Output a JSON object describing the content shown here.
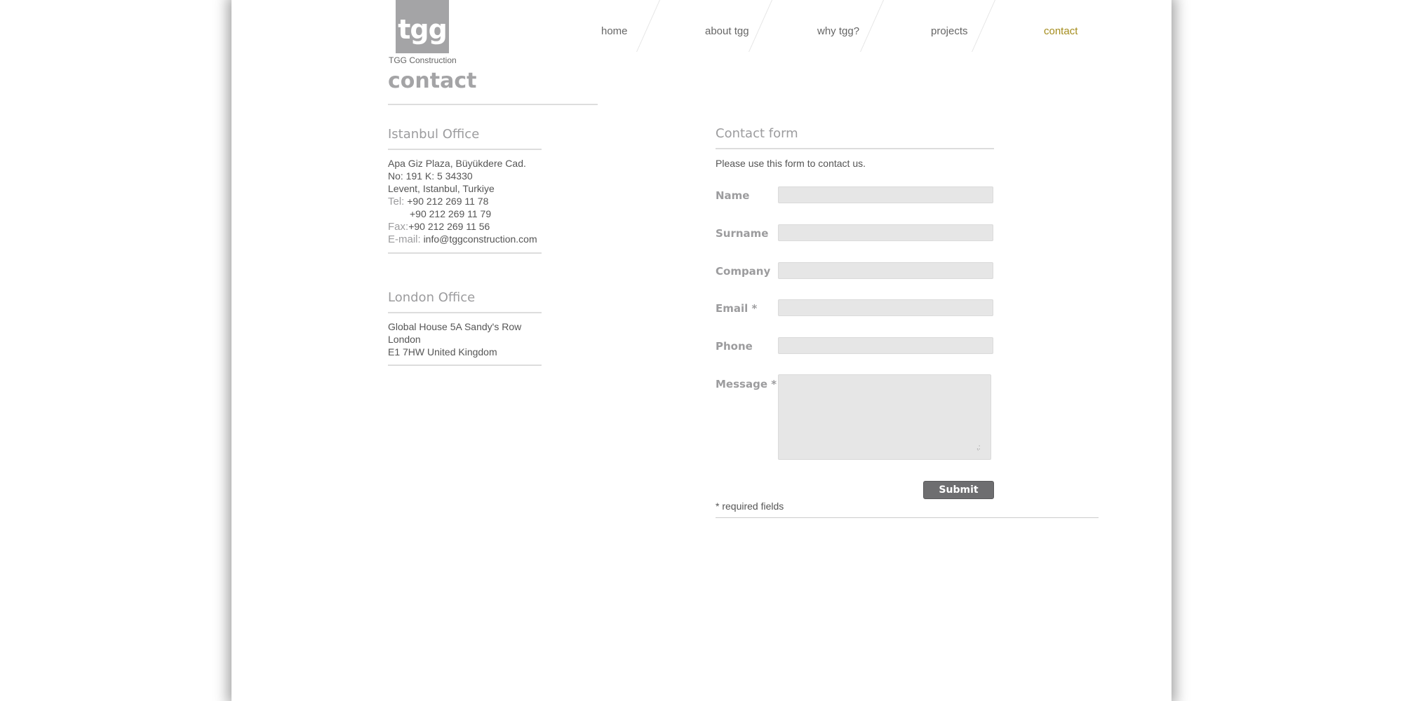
{
  "logo": {
    "mark": "tgg",
    "caption": "TGG Construction"
  },
  "nav": {
    "items": [
      {
        "label": "home"
      },
      {
        "label": "about tgg"
      },
      {
        "label": "why tgg?"
      },
      {
        "label": "projects"
      },
      {
        "label": "contact"
      }
    ],
    "active_color": "#a48c1c"
  },
  "page": {
    "title": "contact"
  },
  "istanbul": {
    "heading": "Istanbul Office",
    "address": [
      "Apa Giz Plaza, Büyükdere Cad.",
      "No: 191 K: 5 34330",
      "Levent, Istanbul, Turkiye"
    ],
    "tel_label": "Tel:",
    "tel_1": "+90 212 269 11 78",
    "tel_2": "+90 212 269 11 79",
    "fax_label": "Fax:",
    "fax": "+90 212 269 11 56",
    "email_label": "E-mail:",
    "email": "info@tggconstruction.com"
  },
  "london": {
    "heading": "London Office",
    "address": [
      "Global House 5A Sandy's Row",
      "London",
      "E1 7HW United Kingdom"
    ]
  },
  "form": {
    "heading": "Contact form",
    "intro": "Please use this form to contact us.",
    "fields": [
      {
        "label": "Name",
        "value": ""
      },
      {
        "label": "Surname",
        "value": ""
      },
      {
        "label": "Company",
        "value": ""
      },
      {
        "label": "Email *",
        "value": ""
      },
      {
        "label": "Phone",
        "value": ""
      },
      {
        "label": "Message *",
        "value": ""
      }
    ],
    "submit_label": "Submit",
    "required_note": "* required fields"
  }
}
